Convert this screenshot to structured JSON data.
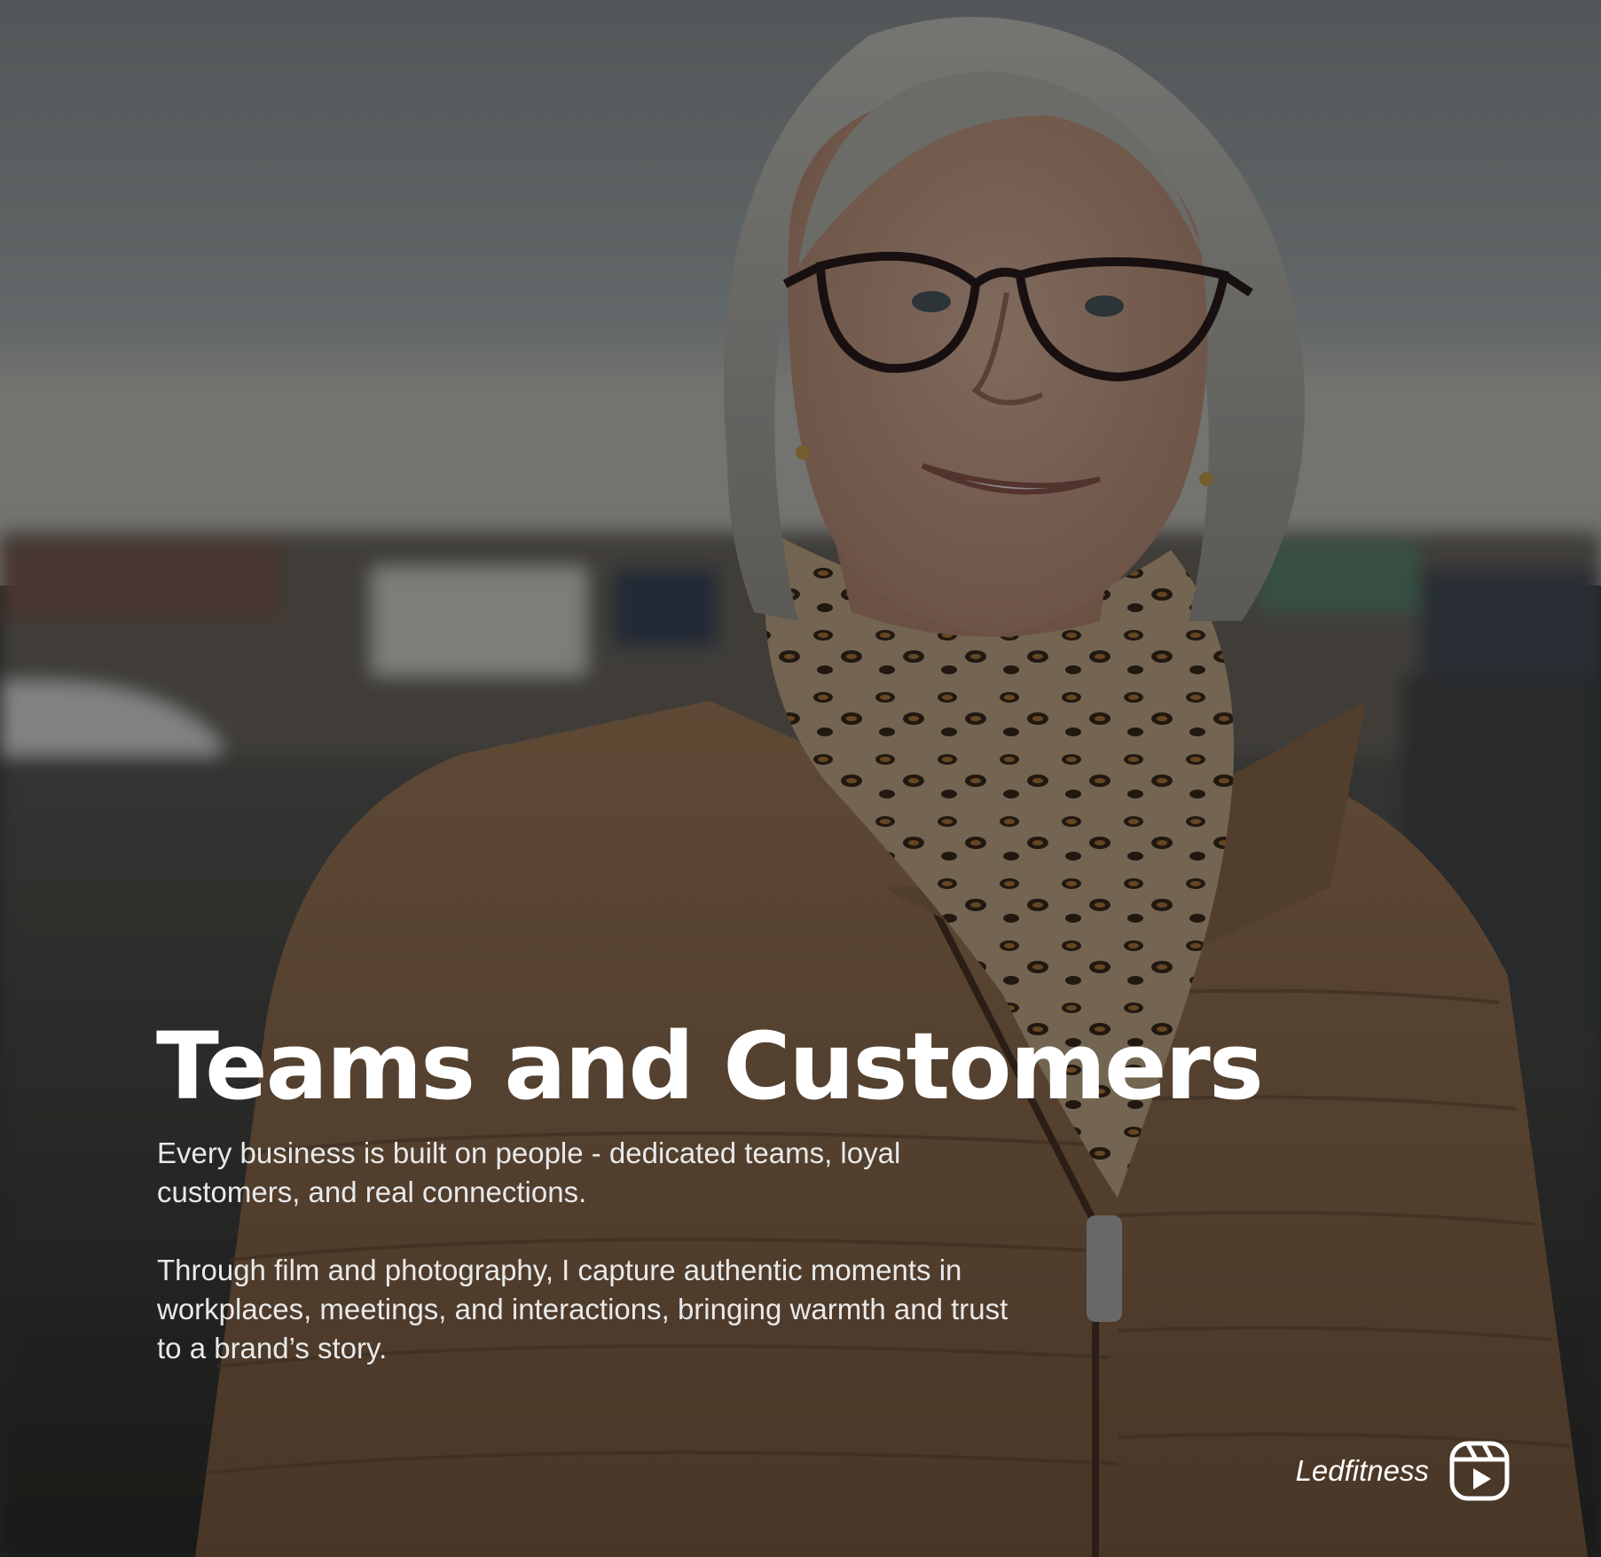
{
  "post": {
    "title": "Teams and Customers",
    "paragraph_1_lines": [
      "Every business is built on people - dedicated teams, loyal",
      "customers, and real connections."
    ],
    "paragraph_2_lines": [
      "Through film and photography, I capture authentic moments in",
      "workplaces, meetings, and interactions, bringing warmth and trust",
      "to a brand’s story."
    ]
  },
  "brand": {
    "name": "Ledfitness",
    "icon": "reels-play-icon"
  },
  "colors": {
    "text": "#ffffff",
    "overlay": "#000000",
    "jacket": "#8a6a4c",
    "sky": "#9aa3a8"
  }
}
